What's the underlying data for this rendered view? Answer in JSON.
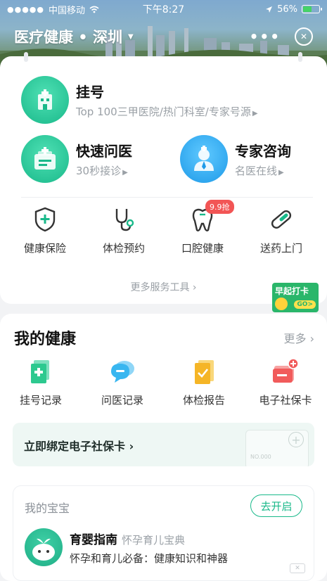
{
  "status_bar": {
    "carrier": "中国移动",
    "time": "下午8:27",
    "battery_text": "56%",
    "battery_level": 0.56,
    "battery_color": "#46d366"
  },
  "nav": {
    "title": "医疗健康 • 深圳",
    "more_icon": "more-dots-icon",
    "close_icon": "close-circle-icon"
  },
  "services": {
    "register": {
      "title": "挂号",
      "subtitle": "Top 100三甲医院/热门科室/专家号源"
    },
    "quick_consult": {
      "title": "快速问医",
      "subtitle": "30秒接诊"
    },
    "expert": {
      "title": "专家咨询",
      "subtitle": "名医在线"
    }
  },
  "quick_tools": [
    {
      "label": "健康保险",
      "icon": "shield-plus-icon"
    },
    {
      "label": "体检预约",
      "icon": "stethoscope-icon"
    },
    {
      "label": "口腔健康",
      "icon": "tooth-icon",
      "badge": "9.9抢"
    },
    {
      "label": "送药上门",
      "icon": "pill-icon"
    }
  ],
  "more_tools": "更多服务工具",
  "early_punch": {
    "label": "早起打卡",
    "go": "GO>"
  },
  "health": {
    "title": "我的健康",
    "more": "更多",
    "items": [
      {
        "label": "挂号记录",
        "icon": "register-record-icon",
        "color": "#2dc98f"
      },
      {
        "label": "问医记录",
        "icon": "chat-bubble-icon",
        "color": "#38b6f0"
      },
      {
        "label": "体检报告",
        "icon": "report-icon",
        "color": "#f5b526"
      },
      {
        "label": "电子社保卡",
        "icon": "social-card-icon",
        "color": "#f15b5b"
      }
    ]
  },
  "bind_banner": {
    "text": "立即绑定电子社保卡",
    "card_no": "NO.000"
  },
  "baby": {
    "title": "我的宝宝",
    "button": "去开启",
    "name": "育婴指南",
    "tag": "怀孕育儿宝典",
    "desc": "怀孕和育儿必备：健康知识和神器"
  },
  "colors": {
    "accent": "#19b98a",
    "blue": "#1e9ae8",
    "badge": "#f25555"
  }
}
